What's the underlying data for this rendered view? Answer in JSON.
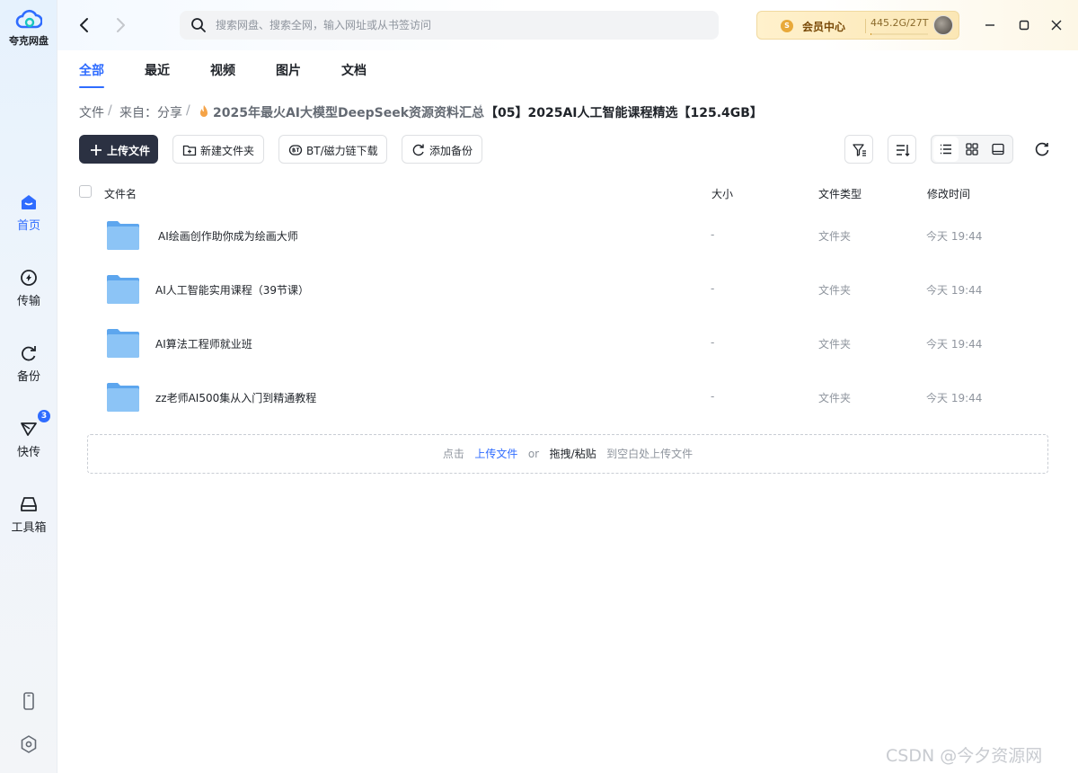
{
  "app": {
    "name": "夸克网盘"
  },
  "sidebar": {
    "items": [
      {
        "label": "首页",
        "icon": "home-icon",
        "active": true
      },
      {
        "label": "传输",
        "icon": "transfer-icon"
      },
      {
        "label": "备份",
        "icon": "backup-icon"
      },
      {
        "label": "快传",
        "icon": "quick-send-icon",
        "badge": "3"
      },
      {
        "label": "工具箱",
        "icon": "toolbox-icon"
      }
    ],
    "bottom_icons": [
      "phone-icon",
      "settings-icon"
    ]
  },
  "topbar": {
    "search_placeholder": "搜索网盘、搜索全网，输入网址或从书签访问",
    "vip_label": "会员中心",
    "vip_coin": "S",
    "storage": "445.2G/27T",
    "storage_used_fraction": 0.016
  },
  "tabs": [
    {
      "label": "全部",
      "active": true
    },
    {
      "label": "最近"
    },
    {
      "label": "视频"
    },
    {
      "label": "图片"
    },
    {
      "label": "文档"
    }
  ],
  "breadcrumb": {
    "items": [
      "文件",
      "来自：分享",
      "2025年最火AI大模型DeepSeek资源资料汇总"
    ],
    "current": "【05】2025AI人工智能课程精选【125.4GB】",
    "separator": "/"
  },
  "toolbar": {
    "upload": "上传文件",
    "new_folder": "新建文件夹",
    "bt_download": "BT/磁力链下载",
    "add_backup": "添加备份"
  },
  "table": {
    "columns": [
      "文件名",
      "大小",
      "文件类型",
      "修改时间"
    ],
    "rows": [
      {
        "name": "AI绘画创作助你成为绘画大师",
        "size": "-",
        "type": "文件夹",
        "modified": "今天 19:44"
      },
      {
        "name": "AI人工智能实用课程（39节课）",
        "size": "-",
        "type": "文件夹",
        "modified": "今天 19:44"
      },
      {
        "name": "AI算法工程师就业班",
        "size": "-",
        "type": "文件夹",
        "modified": "今天 19:44"
      },
      {
        "name": "zz老师AI500集从入门到精通教程",
        "size": "-",
        "type": "文件夹",
        "modified": "今天 19:44"
      }
    ]
  },
  "dropzone": {
    "prefix": "点击",
    "link": "上传文件",
    "or": "or",
    "action": "拖拽/粘贴",
    "suffix": "到空白处上传文件"
  },
  "watermark": "CSDN @今夕资源网",
  "colors": {
    "accent": "#2f6cff",
    "primary_button": "#2b3142",
    "folder": "#6aaef0",
    "vip_gold": "#fbe7b5"
  }
}
